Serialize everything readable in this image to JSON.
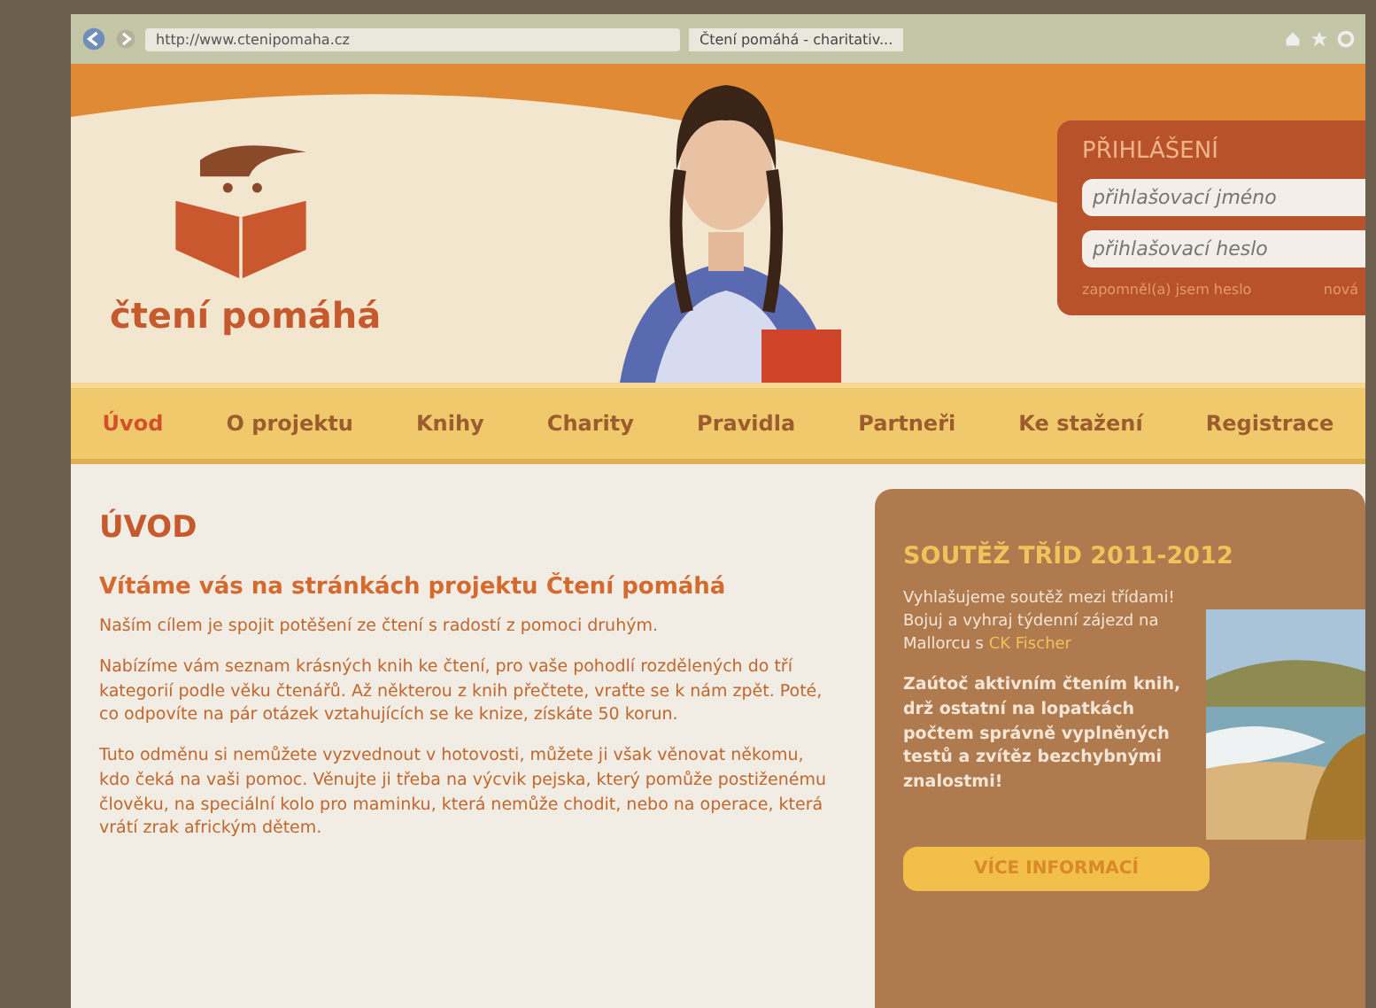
{
  "browser": {
    "address": "http://www.ctenipomaha.cz",
    "tab_title": "Čtení pomáhá - charitativ..."
  },
  "logo": {
    "text": "čtení pomáhá"
  },
  "login": {
    "title": "PŘIHLÁŠENÍ",
    "fields": [
      {
        "placeholder": "přihlašovací jméno"
      },
      {
        "placeholder": "přihlašovací heslo"
      }
    ],
    "links": [
      "zapomněl(a) jsem heslo",
      "nová"
    ]
  },
  "nav": [
    {
      "label": "Úvod",
      "selected": true
    },
    {
      "label": "O projektu",
      "selected": false
    },
    {
      "label": "Knihy",
      "selected": false
    },
    {
      "label": "Charity",
      "selected": false
    },
    {
      "label": "Pravidla",
      "selected": false
    },
    {
      "label": "Partneři",
      "selected": false
    },
    {
      "label": "Ke stažení",
      "selected": false
    },
    {
      "label": "Registrace",
      "selected": false
    }
  ],
  "main": {
    "title": "ÚVOD",
    "subtitle": "Vítáme vás na stránkách projektu Čtení pomáhá",
    "paragraphs": [
      "Naším cílem je spojit potěšení ze čtení s radostí z pomoci druhým.",
      "Nabízíme vám seznam krásných knih ke čtení, pro vaše pohodlí rozdělených do tří kategorií podle věku čtenářů. Až některou z knih přečtete, vraťte se k nám zpět. Poté, co odpovíte na pár otázek vztahujících se ke knize, získáte 50 korun.",
      "Tuto odměnu si nemůžete vyzvednout v hotovosti, můžete ji však věnovat někomu, kdo čeká na vaši pomoc. Věnujte ji třeba na výcvik pejska, který pomůže postiženému člověku, na speciální kolo pro maminku, která nemůže chodit, nebo na operace, která vrátí zrak africkým dětem."
    ]
  },
  "contest": {
    "title": "SOUTĚŽ TŘÍD 2011-2012",
    "intro": "Vyhlašujeme soutěž mezi třídami! Bojuj a vyhraj týdenní zájezd na Mallorcu s",
    "link": "CK Fischer",
    "text": "Zaútoč aktivním čtením knih, drž ostatní na lopatkách počtem správně vyplněných testů a zvítěz bezchybnými znalostmi!",
    "button": "VÍCE INFORMACÍ"
  }
}
